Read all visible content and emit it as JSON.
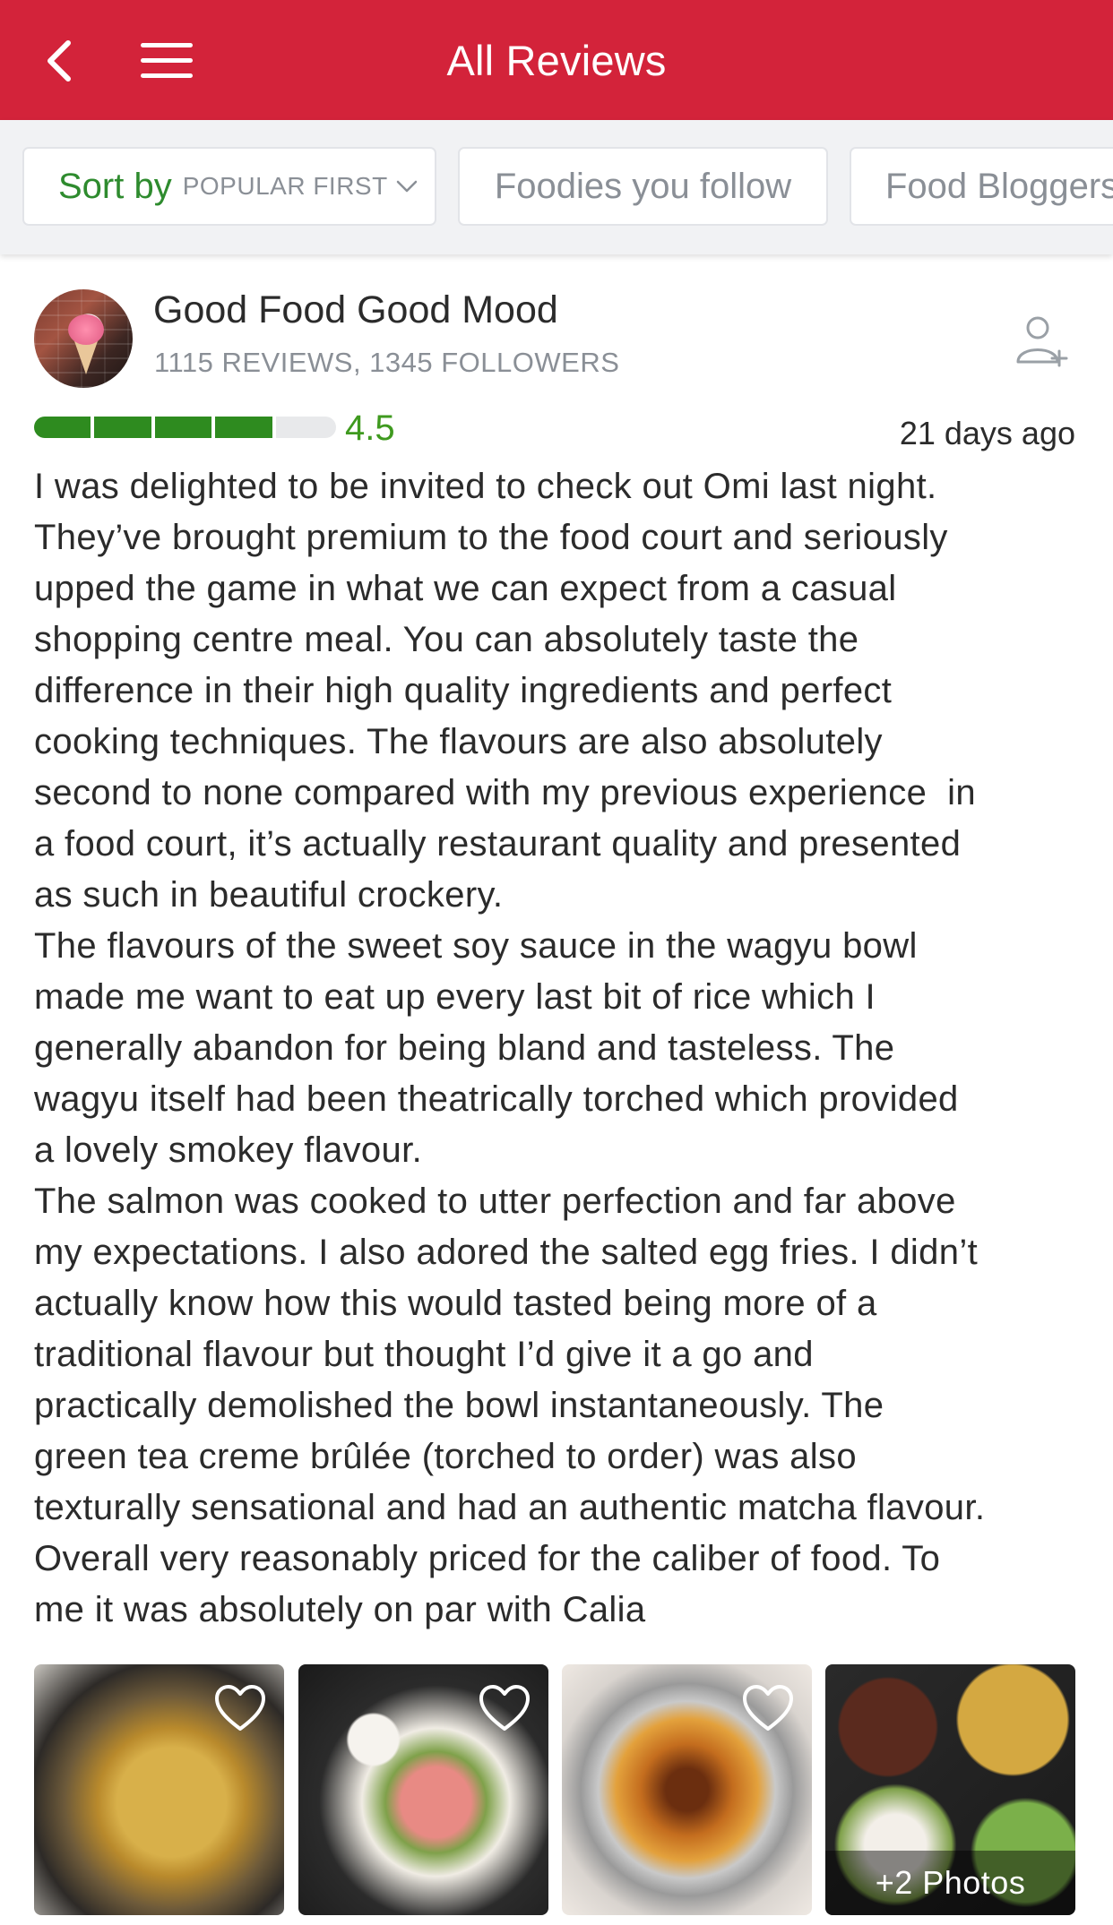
{
  "header": {
    "title": "All Reviews",
    "back_icon": "chevron-left-icon",
    "menu_icon": "hamburger-menu-icon",
    "background_color": "#d3233a"
  },
  "filters": {
    "sort_label": "Sort by",
    "sort_value": "POPULAR FIRST",
    "chips": [
      "Foodies you follow",
      "Food Bloggers"
    ]
  },
  "review": {
    "user_name": "Good Food Good Mood",
    "user_stats": "1115 REVIEWS, 1345 FOLLOWERS",
    "follow_icon": "add-user-icon",
    "rating": 4.5,
    "rating_display": "4.5",
    "rating_color": "#3f9a1f",
    "time_ago": "21 days ago",
    "text": "I was delighted to be invited to check out Omi last night.\nThey’ve brought premium to the food court and seriously\nupped the game in what we can expect from a casual\nshopping centre meal. You can absolutely taste the\ndifference in their high quality ingredients and perfect\ncooking techniques. The flavours are also absolutely\nsecond to none compared with my previous experience  in\na food court, it’s actually restaurant quality and presented\nas such in beautiful crockery.\nThe flavours of the sweet soy sauce in the wagyu bowl\nmade me want to eat up every last bit of rice which I\ngenerally abandon for being bland and tasteless. The\nwagyu itself had been theatrically torched which provided\na lovely smokey flavour.\nThe salmon was cooked to utter perfection and far above\nmy expectations. I also adored the salted egg fries. I didn’t\nactually know how this would tasted being more of a\ntraditional flavour but thought I’d give it a go and\npractically demolished the bowl instantaneously. The\ngreen tea creme brûlée (torched to order) was also\ntexturally sensational and had an authentic matcha flavour.\nOverall very reasonably priced for the caliber of food. To\nme it was absolutely on par with Calia",
    "more_photos_label": "+2 Photos"
  }
}
